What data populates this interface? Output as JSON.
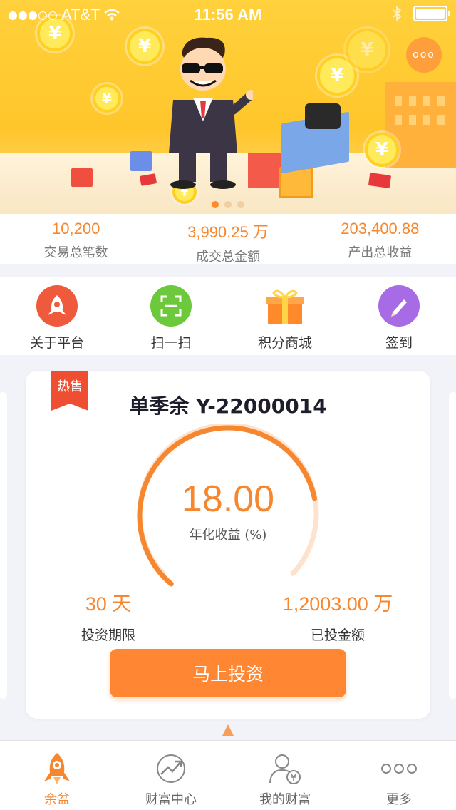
{
  "status_bar": {
    "carrier": "AT&T",
    "time": "11:56 AM"
  },
  "banner": {
    "coin_symbol": "¥",
    "more_label": "ooo"
  },
  "stats": [
    {
      "value": "10,200",
      "label": "交易总笔数"
    },
    {
      "value": "3,990.25 万",
      "label": "成交总金额"
    },
    {
      "value": "203,400.88",
      "label": "产出总收益"
    }
  ],
  "quick_actions": [
    {
      "label": "关于平台",
      "icon": "rocket-icon",
      "color": "#f05a3c"
    },
    {
      "label": "扫一扫",
      "icon": "scan-icon",
      "color": "#6cc93b"
    },
    {
      "label": "积分商城",
      "icon": "gift-icon",
      "color": "#ff8a2b"
    },
    {
      "label": "签到",
      "icon": "pencil-icon",
      "color": "#a76be6"
    }
  ],
  "product": {
    "badge": "热售",
    "title": "单季余 Y-22000014",
    "rate": "18.00",
    "rate_label": "年化收益 (%)",
    "term_value": "30 天",
    "term_label": "投资期限",
    "invested_value": "1,2003.00 万",
    "invested_label": "已投金额",
    "invest_button": "马上投资",
    "progress": 0.78
  },
  "tabbar": [
    {
      "label": "余盆",
      "icon": "rocket-icon",
      "active": true
    },
    {
      "label": "财富中心",
      "icon": "trend-icon",
      "active": false
    },
    {
      "label": "我的财富",
      "icon": "user-yen-icon",
      "active": false
    },
    {
      "label": "更多",
      "icon": "more-dots-icon",
      "active": false
    }
  ],
  "colors": {
    "accent": "#f7872f",
    "hot": "#ee4f33"
  }
}
